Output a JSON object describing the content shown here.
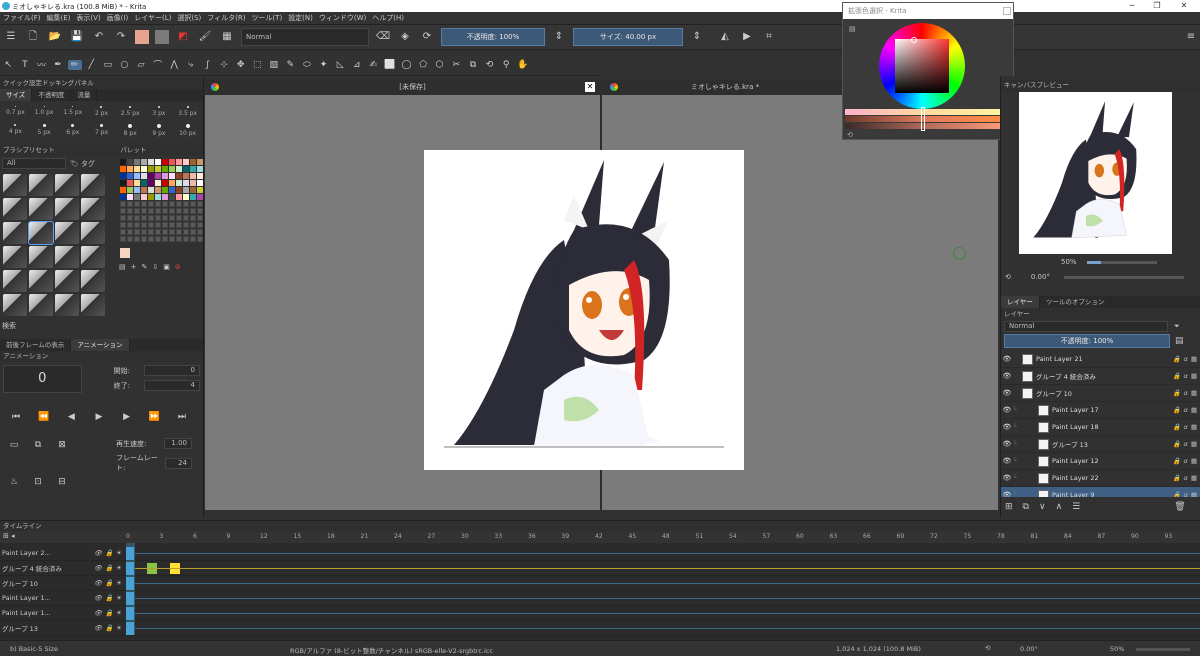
{
  "window": {
    "title": "ミオしゃキレる.kra (100.8 MiB)  * - Krita",
    "minimize": "─",
    "maximize": "❐",
    "close": "✕"
  },
  "menu": [
    "ファイル(F)",
    "編集(E)",
    "表示(V)",
    "画像(I)",
    "レイヤー(L)",
    "選択(S)",
    "フィルタ(R)",
    "ツール(T)",
    "設定(N)",
    "ウィンドウ(W)",
    "ヘルプ(H)"
  ],
  "toolbar": {
    "blend_mode": "Normal",
    "opacity_label": "不透明度: 100%",
    "size_label": "サイズ: 40.00 px"
  },
  "tools": [
    "↖",
    "T",
    "〰",
    "✒",
    "✏",
    "╱",
    "▭",
    "○",
    "▱",
    "⌒",
    "⋀",
    "⤷",
    "∫",
    "⊹",
    "✥",
    "⬚",
    "▧",
    "✎",
    "⬭",
    "✦",
    "◺",
    "⊿",
    "✍",
    "⬜",
    "◯",
    "⬠",
    "⬡",
    "✂",
    "⧉",
    "⟲",
    "⚲",
    "✋"
  ],
  "left_panel": {
    "quick_settings_title": "クイック設定ドッキングパネル",
    "quick_tabs": [
      "サイズ",
      "不透明度",
      "流量"
    ],
    "sizes": [
      "0.7 px",
      "1.0 px",
      "1.5 px",
      "2 px",
      "2.5 px",
      "3 px",
      "3.5 px",
      "4 px",
      "5 px",
      "6 px",
      "7 px",
      "8 px",
      "9 px",
      "10 px"
    ],
    "brush_presets_title": "ブラシプリセット",
    "brush_filter": "All",
    "brush_tag": "タグ",
    "palette_title": "パレット",
    "search_label": "検索",
    "anim_tabs": [
      "前後フレームの表示",
      "アニメーション"
    ],
    "animation_title": "アニメーション",
    "current_frame": "0",
    "start_label": "開始:",
    "start_value": "0",
    "end_label": "終了:",
    "end_value": "4",
    "speed_label": "再生速度:",
    "speed_value": "1.00",
    "fps_label": "フレームレート:",
    "fps_value": "24"
  },
  "doc_tabs": [
    "[未保存]",
    "ミオしゃキレる.kra *"
  ],
  "color_popup": {
    "title": "拡張色選択 - Krita"
  },
  "right_panel": {
    "preview_title": "キャンバスプレビュー",
    "zoom": "50%",
    "rotation": "0.00°",
    "tabs": [
      "レイヤー",
      "ツールのオプション"
    ],
    "layers_title": "レイヤー",
    "blend": "Normal",
    "opacity": "不透明度: 100%",
    "layers": [
      {
        "name": "Paint Layer 21",
        "indent": 0,
        "selected": false
      },
      {
        "name": "グループ 4 統合済み",
        "indent": 0,
        "selected": false
      },
      {
        "name": "グループ 10",
        "indent": 0,
        "selected": false
      },
      {
        "name": "Paint Layer 17",
        "indent": 1,
        "selected": false
      },
      {
        "name": "Paint Layer 18",
        "indent": 1,
        "selected": false
      },
      {
        "name": "グループ 13",
        "indent": 1,
        "selected": false
      },
      {
        "name": "Paint Layer 12",
        "indent": 1,
        "selected": false
      },
      {
        "name": "Paint Layer 22",
        "indent": 1,
        "selected": false
      },
      {
        "name": "Paint Layer 9",
        "indent": 1,
        "selected": true
      }
    ]
  },
  "timeline": {
    "title": "タイムライン",
    "frames": [
      "0",
      "3",
      "6",
      "9",
      "12",
      "15",
      "18",
      "21",
      "24",
      "27",
      "30",
      "33",
      "36",
      "39",
      "42",
      "45",
      "48",
      "51",
      "54",
      "57",
      "60",
      "63",
      "66",
      "69",
      "72",
      "75",
      "78",
      "81",
      "84",
      "87",
      "90",
      "93"
    ],
    "rows": [
      "Paint Layer 2...",
      "グループ 4 統合済み",
      "グループ 10",
      "Paint Layer 1...",
      "Paint Layer 1...",
      "グループ 13"
    ]
  },
  "status": {
    "brush": "b) Basic-5 Size",
    "color_info": "RGB/アルファ (8-ビット整数/チャンネル)  sRGB-elle-V2-srgbtrc.icc",
    "dimensions": "1,024 x 1,024 (100.8 MiB)",
    "rotation": "0.00°",
    "zoom": "50%"
  },
  "colors": {
    "accent": "#3d5978",
    "selection": "#3f5f85",
    "key_green": "#8bc34a",
    "key_yellow": "#ffe033",
    "key_blue": "#4aa3d8"
  }
}
